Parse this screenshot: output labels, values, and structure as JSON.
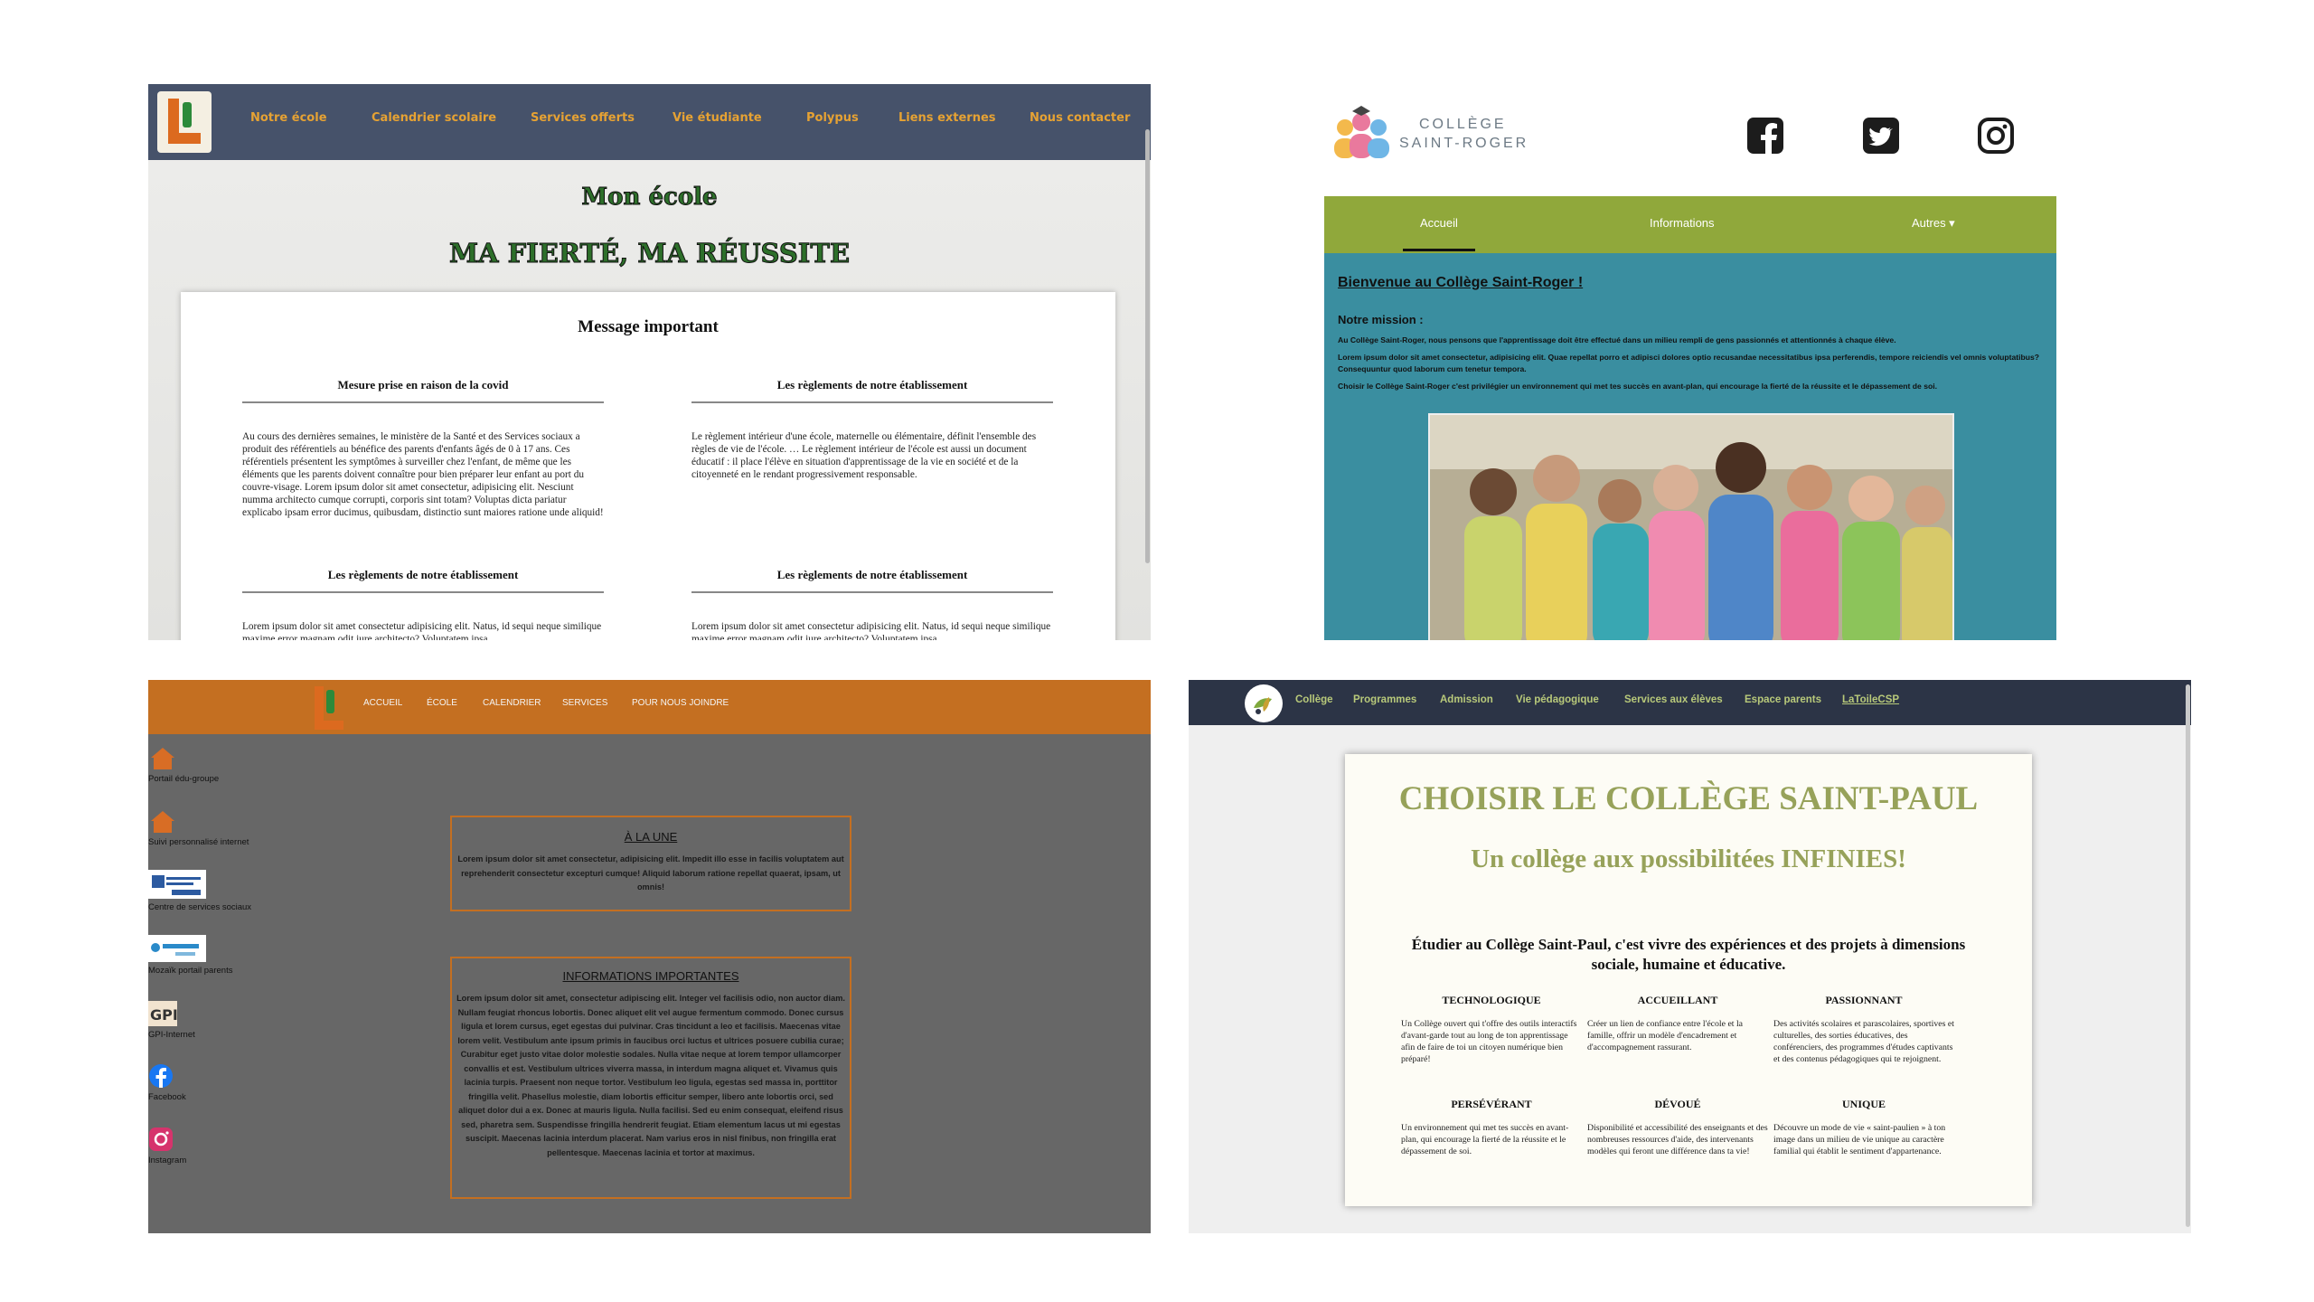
{
  "q1": {
    "nav": [
      "Notre école",
      "Calendrier scolaire",
      "Services offerts",
      "Vie étudiante",
      "Polypus",
      "Liens externes",
      "Nous contacter"
    ],
    "heading": "Mon école",
    "slogan": "MA FIERTÉ, MA RÉUSSITE",
    "card_title": "Message important",
    "col1_title": "Mesure prise en raison de la covid",
    "col1_text": "Au cours des dernières semaines, le ministère de la Santé et des Services sociaux a produit des référentiels au bénéfice des parents d'enfants âgés de 0 à 17 ans. Ces référentiels présentent les symptômes à surveiller chez l'enfant, de même que les éléments que les parents doivent connaître pour bien préparer leur enfant au port du couvre-visage. Lorem ipsum dolor sit amet consectetur, adipisicing elit. Nesciunt numma architecto cumque corrupti, corporis sint totam? Voluptas dicta pariatur explicabo ipsam error ducimus, quibusdam, distinctio sunt maiores ratione unde aliquid!",
    "col2_title": "Les règlements de notre établissement",
    "col2_text": "Le règlement intérieur d'une école, maternelle ou élémentaire, définit l'ensemble des règles de vie de l'école. … Le règlement intérieur de l'école est aussi un document éducatif : il place l'élève en situation d'apprentissage de la vie en société et de la citoyenneté en le rendant progressivement responsable.",
    "col3_title": "Les règlements de notre établissement",
    "col3_text": "Lorem ipsum dolor sit amet consectetur adipisicing elit. Natus, id sequi neque similique maxime error magnam odit iure architecto? Voluptatem ipsa",
    "col4_title": "Les règlements de notre établissement",
    "col4_text": "Lorem ipsum dolor sit amet consectetur adipisicing elit. Natus, id sequi neque similique maxime error magnam odit iure architecto? Voluptatem ipsa"
  },
  "q2": {
    "brand_line1": "COLLÈGE",
    "brand_line2": "SAINT-ROGER",
    "tabs": [
      "Accueil",
      "Informations",
      "Autres ▾"
    ],
    "welcome": "Bienvenue au Collège Saint-Roger !",
    "mission_label": "Notre mission :",
    "para1": "Au Collège Saint-Roger, nous pensons que l'apprentissage doit être effectué dans un milieu rempli de gens passionnés et attentionnés à chaque élève.",
    "para2": "Lorem ipsum dolor sit amet consectetur, adipisicing elit. Quae repellat porro et adipisci dolores optio recusandae necessitatibus ipsa perferendis, tempore reiciendis vel omnis voluptatibus? Consequuntur quod laborum cum tenetur tempora.",
    "para3": "Choisir le Collège Saint-Roger c'est privilégier un environnement qui met tes succès en avant-plan, qui encourage la fierté de la réussite et le dépassement de soi."
  },
  "q3": {
    "nav": [
      "ACCUEIL",
      "ÉCOLE",
      "CALENDRIER",
      "SERVICES",
      "POUR NOUS JOINDRE"
    ],
    "side": [
      "Portail édu-groupe",
      "Suivi personnalisé internet",
      "Centre de services sociaux",
      "Mozaïk portail parents",
      "GPI-Internet",
      "Facebook",
      "Instagram"
    ],
    "box1_title": "À LA UNE",
    "box1_text": "Lorem ipsum dolor sit amet consectetur, adipisicing elit. Impedit illo esse in facilis voluptatem aut reprehenderit consectetur excepturi cumque! Aliquid laborum ratione repellat quaerat, ipsam, ut omnis!",
    "box2_title": "INFORMATIONS IMPORTANTES",
    "box2_text": "Lorem ipsum dolor sit amet, consectetur adipiscing elit. Integer vel facilisis odio, non auctor diam. Nullam feugiat rhoncus lobortis. Donec aliquet elit vel augue fermentum commodo. Donec cursus ligula et lorem cursus, eget egestas dui pulvinar. Cras tincidunt a leo et facilisis. Maecenas vitae lorem velit. Vestibulum ante ipsum primis in faucibus orci luctus et ultrices posuere cubilia curae; Curabitur eget justo vitae dolor molestie sodales. Nulla vitae neque at lorem tempor ullamcorper convallis et est. Vestibulum ultrices viverra massa, in interdum magna aliquet et. Vivamus quis lacinia turpis. Praesent non neque tortor. Vestibulum leo ligula, egestas sed massa in, porttitor fringilla velit. Phasellus molestie, diam lobortis efficitur semper, libero ante lobortis orci, sed aliquet dolor dui a ex. Donec at mauris ligula. Nulla facilisi. Sed eu enim consequat, eleifend risus sed, pharetra sem. Suspendisse fringilla hendrerit feugiat. Etiam elementum lacus ut mi egestas suscipit. Maecenas lacinia interdum placerat. Nam varius eros in nisl finibus, non fringilla erat pellentesque. Maecenas lacinia et tortor at maximus."
  },
  "q4": {
    "nav": [
      "Collège",
      "Programmes",
      "Admission",
      "Vie pédagogique",
      "Services aux élèves",
      "Espace parents",
      "LaToileCSP"
    ],
    "title": "CHOISIR LE COLLÈGE SAINT-PAUL",
    "subtitle": "Un collège aux possibilitées INFINIES!",
    "intro": "Étudier au Collège Saint-Paul, c'est vivre des expériences et des projets à dimensions sociale, humaine et éducative.",
    "cols": [
      {
        "title": "TECHNOLOGIQUE",
        "text": "Un Collège ouvert qui t'offre des outils interactifs d'avant-garde tout au long de ton apprentissage afin de faire de toi un citoyen numérique bien préparé!"
      },
      {
        "title": "ACCUEILLANT",
        "text": "Créer un lien de confiance entre l'école et la famille, offrir un modèle d'encadrement et d'accompagnement rassurant."
      },
      {
        "title": "PASSIONNANT",
        "text": "Des activités scolaires et parascolaires, sportives et culturelles, des sorties éducatives, des conférenciers, des programmes d'études captivants et des contenus pédagogiques qui te rejoignent."
      },
      {
        "title": "PERSÉVÉRANT",
        "text": "Un environnement qui met tes succès en avant-plan, qui encourage la fierté de la réussite et le dépassement de soi."
      },
      {
        "title": "DÉVOUÉ",
        "text": "Disponibilité et accessibilité des enseignants et des nombreuses ressources d'aide, des intervenants modèles qui feront une différence dans ta vie!"
      },
      {
        "title": "UNIQUE",
        "text": "Découvre un mode de vie « saint-paulien » à ton image dans un milieu de vie unique au caractère familial qui établit le sentiment d'appartenance."
      }
    ]
  }
}
